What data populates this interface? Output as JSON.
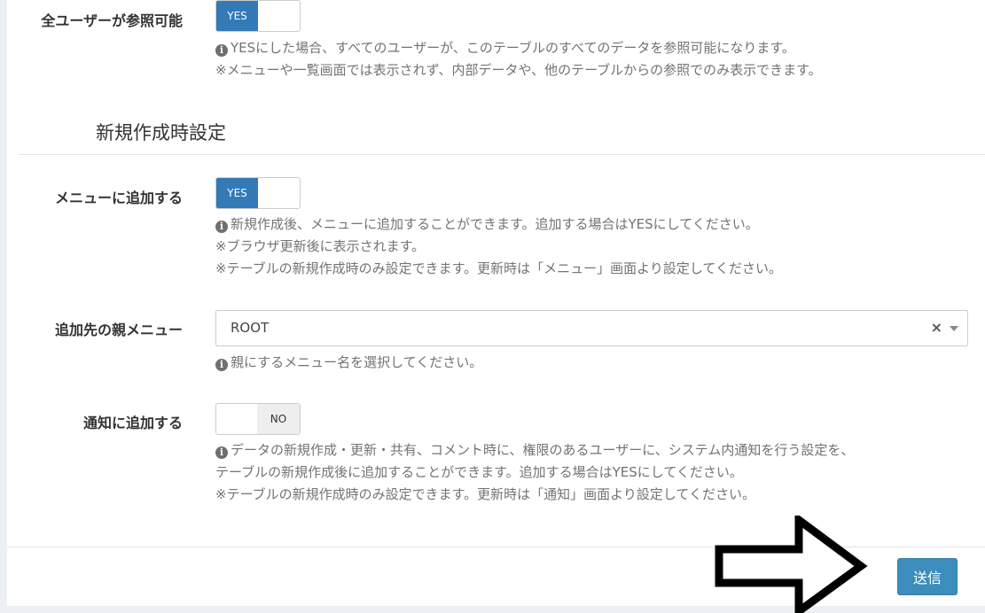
{
  "public_all_users": {
    "label": "全ユーザーが参照可能",
    "toggle_on": "YES",
    "help1": "YESにした場合、すべてのユーザーが、このテーブルのすべてのデータを参照可能になります。",
    "help2": "※メニューや一覧画面では表示されず、内部データや、他のテーブルからの参照でのみ表示できます。"
  },
  "section": {
    "title": "新規作成時設定"
  },
  "add_to_menu": {
    "label": "メニューに追加する",
    "toggle_on": "YES",
    "help1": "新規作成後、メニューに追加することができます。追加する場合はYESにしてください。",
    "help2": "※ブラウザ更新後に表示されます。",
    "help3": "※テーブルの新規作成時のみ設定できます。更新時は「メニュー」画面より設定してください。"
  },
  "parent_menu": {
    "label": "追加先の親メニュー",
    "selected": "ROOT",
    "clear": "×",
    "help1": "親にするメニュー名を選択してください。"
  },
  "add_notification": {
    "label": "通知に追加する",
    "toggle_off": "NO",
    "help1": "データの新規作成・更新・共有、コメント時に、権限のあるユーザーに、システム内通知を行う設定を、",
    "help2": "テーブルの新規作成後に追加することができます。追加する場合はYESにしてください。",
    "help3": "※テーブルの新規作成時のみ設定できます。更新時は「通知」画面より設定してください。"
  },
  "footer": {
    "submit_label": "送信"
  },
  "icons": {
    "info": "info-circle-icon",
    "arrow": "right-arrow-icon",
    "caret": "chevron-down-icon"
  },
  "colors": {
    "accent": "#337ab7",
    "submit": "#3c8dbc"
  }
}
